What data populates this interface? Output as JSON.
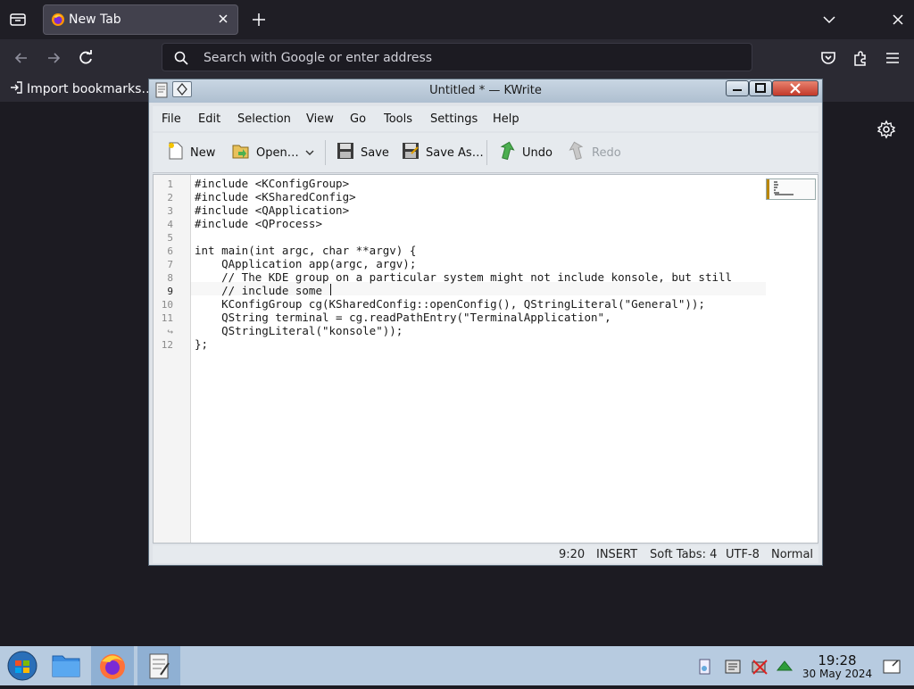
{
  "browser": {
    "tab_title": "New Tab",
    "urlbar_placeholder": "Search with Google or enter address",
    "bookmark_import_label": "Import bookmarks…"
  },
  "kwrite": {
    "title": "Untitled * — KWrite",
    "menu": [
      "File",
      "Edit",
      "Selection",
      "View",
      "Go",
      "Tools",
      "Settings",
      "Help"
    ],
    "toolbar": {
      "new": "New",
      "open": "Open…",
      "save": "Save",
      "save_as": "Save As…",
      "undo": "Undo",
      "redo": "Redo"
    },
    "gutter": [
      "1",
      "2",
      "3",
      "4",
      "5",
      "6",
      "7",
      "8",
      "9",
      "10",
      "11",
      "↪",
      "12"
    ],
    "code": [
      "#include <KConfigGroup>",
      "#include <KSharedConfig>",
      "#include <QApplication>",
      "#include <QProcess>",
      "",
      "int main(int argc, char **argv) {",
      "    QApplication app(argc, argv);",
      "    // The KDE group on a particular system might not include konsole, but still",
      "    // include some",
      "    KConfigGroup cg(KSharedConfig::openConfig(), QStringLiteral(\"General\"));",
      "    QString terminal = cg.readPathEntry(\"TerminalApplication\",",
      "    QStringLiteral(\"konsole\"));",
      "};"
    ],
    "status": {
      "cursor": "9:20",
      "mode": "INSERT",
      "tabs": "Soft Tabs: 4",
      "encoding": "UTF-8",
      "input_mode": "Normal"
    }
  },
  "taskbar": {
    "time": "19:28",
    "date": "30 May 2024"
  }
}
